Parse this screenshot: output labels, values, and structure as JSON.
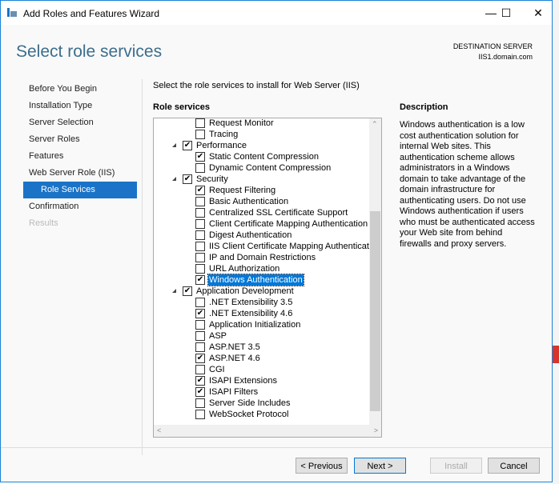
{
  "window": {
    "title": "Add Roles and Features Wizard"
  },
  "header": {
    "page_title": "Select role services",
    "destination_label": "DESTINATION SERVER",
    "destination_server": "IIS1.domain.com"
  },
  "nav": [
    {
      "label": "Before You Begin",
      "state": "normal"
    },
    {
      "label": "Installation Type",
      "state": "normal"
    },
    {
      "label": "Server Selection",
      "state": "normal"
    },
    {
      "label": "Server Roles",
      "state": "normal"
    },
    {
      "label": "Features",
      "state": "normal"
    },
    {
      "label": "Web Server Role (IIS)",
      "state": "normal"
    },
    {
      "label": "Role Services",
      "state": "selected"
    },
    {
      "label": "Confirmation",
      "state": "normal"
    },
    {
      "label": "Results",
      "state": "disabled"
    }
  ],
  "main": {
    "instruction": "Select the role services to install for Web Server (IIS)",
    "role_services_label": "Role services",
    "description_label": "Description",
    "description": "Windows authentication is a low cost authentication solution for internal Web sites. This authentication scheme allows administrators in a Windows domain to take advantage of the domain infrastructure for authenticating users. Do not use Windows authentication if users who must be authenticated access your Web site from behind firewalls and proxy servers.",
    "tree": [
      {
        "label": "Request Monitor",
        "level": 2,
        "checked": false
      },
      {
        "label": "Tracing",
        "level": 2,
        "checked": false
      },
      {
        "label": "Performance",
        "level": 1,
        "checked": true,
        "expanded": true
      },
      {
        "label": "Static Content Compression",
        "level": 2,
        "checked": true
      },
      {
        "label": "Dynamic Content Compression",
        "level": 2,
        "checked": false
      },
      {
        "label": "Security",
        "level": 1,
        "checked": true,
        "expanded": true
      },
      {
        "label": "Request Filtering",
        "level": 2,
        "checked": true
      },
      {
        "label": "Basic Authentication",
        "level": 2,
        "checked": false
      },
      {
        "label": "Centralized SSL Certificate Support",
        "level": 2,
        "checked": false
      },
      {
        "label": "Client Certificate Mapping Authentication",
        "level": 2,
        "checked": false
      },
      {
        "label": "Digest Authentication",
        "level": 2,
        "checked": false
      },
      {
        "label": "IIS Client Certificate Mapping Authentication",
        "level": 2,
        "checked": false
      },
      {
        "label": "IP and Domain Restrictions",
        "level": 2,
        "checked": false
      },
      {
        "label": "URL Authorization",
        "level": 2,
        "checked": false
      },
      {
        "label": "Windows Authentication",
        "level": 2,
        "checked": true,
        "selected": true
      },
      {
        "label": "Application Development",
        "level": 1,
        "checked": true,
        "expanded": true
      },
      {
        "label": ".NET Extensibility 3.5",
        "level": 2,
        "checked": false
      },
      {
        "label": ".NET Extensibility 4.6",
        "level": 2,
        "checked": true
      },
      {
        "label": "Application Initialization",
        "level": 2,
        "checked": false
      },
      {
        "label": "ASP",
        "level": 2,
        "checked": false
      },
      {
        "label": "ASP.NET 3.5",
        "level": 2,
        "checked": false
      },
      {
        "label": "ASP.NET 4.6",
        "level": 2,
        "checked": true
      },
      {
        "label": "CGI",
        "level": 2,
        "checked": false
      },
      {
        "label": "ISAPI Extensions",
        "level": 2,
        "checked": true
      },
      {
        "label": "ISAPI Filters",
        "level": 2,
        "checked": true
      },
      {
        "label": "Server Side Includes",
        "level": 2,
        "checked": false
      },
      {
        "label": "WebSocket Protocol",
        "level": 2,
        "checked": false
      }
    ]
  },
  "buttons": {
    "previous": "< Previous",
    "next": "Next >",
    "install": "Install",
    "cancel": "Cancel"
  },
  "colors": {
    "accent": "#1a73c7",
    "title": "#3c6e8c",
    "selection": "#0078d7"
  }
}
